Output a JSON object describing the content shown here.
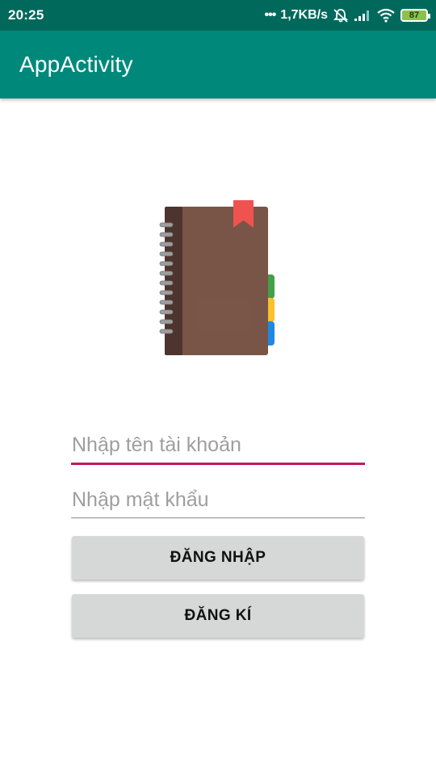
{
  "status_bar": {
    "time": "20:25",
    "dots": "•••",
    "network_speed": "1,7KB/s",
    "battery_level": "87",
    "icons": [
      "mute-alarm-icon",
      "signal-icon",
      "wifi-icon",
      "battery-icon"
    ]
  },
  "toolbar": {
    "title": "AppActivity"
  },
  "logo": {
    "icon": "notebook-icon",
    "colors": {
      "cover": "#795548",
      "spine": "#4e342e",
      "bookmark": "#ef5350",
      "tab_green": "#43a047",
      "tab_yellow": "#fbc02d",
      "tab_blue": "#1e88e5"
    }
  },
  "form": {
    "username": {
      "value": "",
      "placeholder": "Nhập tên tài khoản"
    },
    "password": {
      "value": "",
      "placeholder": "Nhập mật khẩu"
    },
    "login_label": "ĐĂNG NHẬP",
    "register_label": "ĐĂNG KÍ"
  },
  "theme": {
    "primary_dark": "#00695c",
    "primary": "#00897b",
    "accent": "#c2185b",
    "button": "#d6d7d7"
  }
}
